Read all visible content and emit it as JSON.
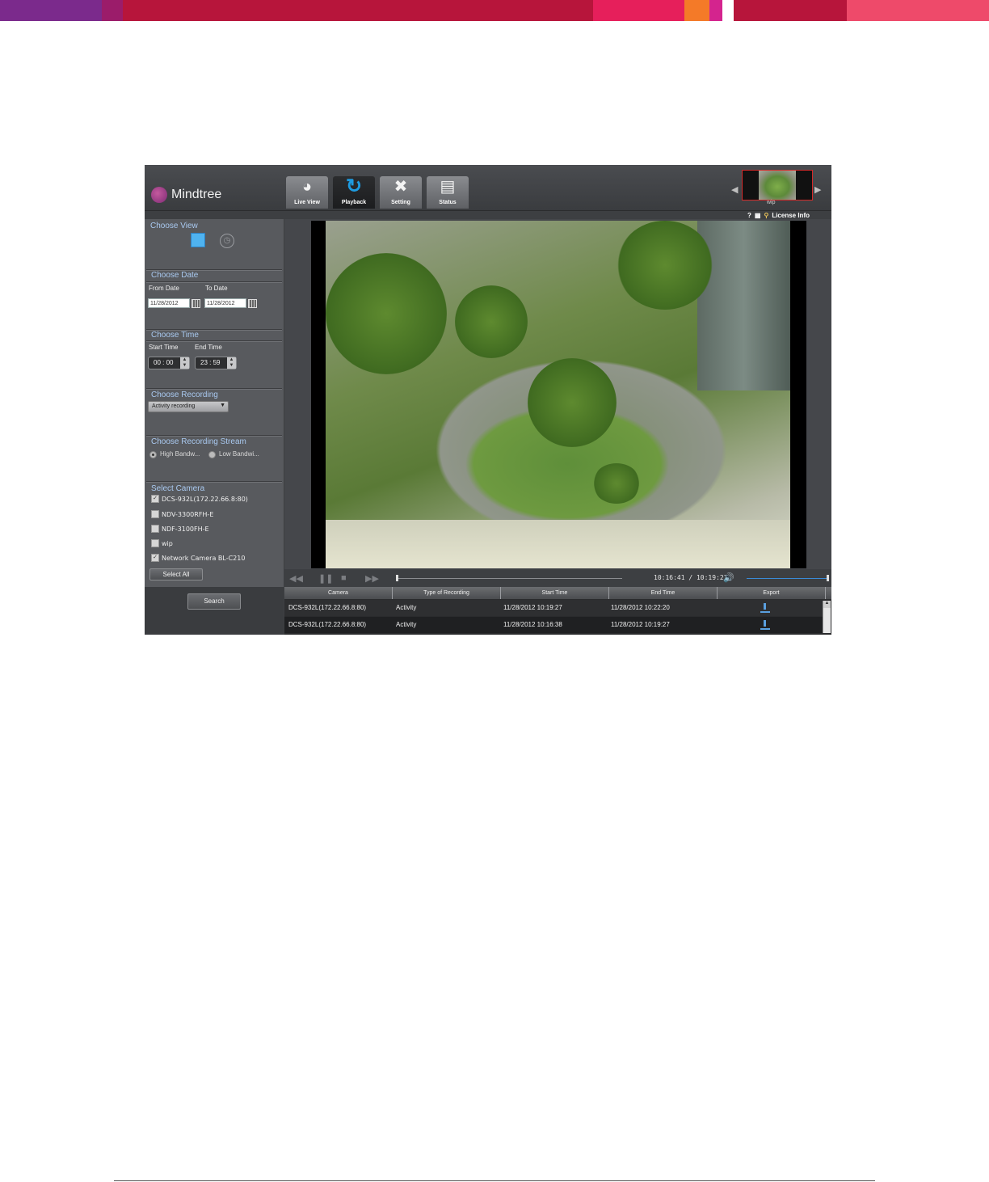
{
  "brand": {
    "name": "Mindtree"
  },
  "colors": {
    "accent": "#1e9be0",
    "section_title": "#a9c9f0",
    "panel": "#585a5e",
    "frame": "#3d3f42"
  },
  "nav": {
    "tabs": [
      {
        "label": "Live View",
        "icon": "dome-camera-icon"
      },
      {
        "label": "Playback",
        "icon": "refresh-icon",
        "active": true
      },
      {
        "label": "Setting",
        "icon": "tools-icon"
      },
      {
        "label": "Status",
        "icon": "document-icon"
      }
    ]
  },
  "camera_thumb": {
    "caption": "wip"
  },
  "util": {
    "help": "?",
    "license": "License Info"
  },
  "choose_view": {
    "title": "Choose View"
  },
  "choose_date": {
    "title": "Choose Date",
    "from_label": "From Date",
    "to_label": "To Date",
    "from_value": "11/28/2012",
    "to_value": "11/28/2012"
  },
  "choose_time": {
    "title": "Choose Time",
    "start_label": "Start Time",
    "end_label": "End Time",
    "start_value": "00 : 00",
    "end_value": "23 : 59"
  },
  "choose_recording": {
    "title": "Choose Recording",
    "selected": "Activity recording"
  },
  "choose_stream": {
    "title": "Choose Recording Stream",
    "high": "High Bandw...",
    "low": "Low Bandwi..."
  },
  "select_camera": {
    "title": "Select Camera",
    "cameras": [
      {
        "name": "DCS-932L(172.22.66.8:80)",
        "checked": true
      },
      {
        "name": "NDV-3300RFH-E",
        "checked": false
      },
      {
        "name": "NDF-3100FH-E",
        "checked": false
      },
      {
        "name": "wip",
        "checked": false
      },
      {
        "name": "Network Camera BL-C210",
        "checked": true
      }
    ],
    "select_all": "Select All"
  },
  "search": {
    "label": "Search"
  },
  "player": {
    "time": "10:16:41 / 10:19:27"
  },
  "results": {
    "columns": [
      "Camera",
      "Type of Recording",
      "Start Time",
      "End Time",
      "Export"
    ],
    "rows": [
      {
        "camera": "DCS-932L(172.22.66.8:80)",
        "type": "Activity",
        "start": "11/28/2012 10:19:27",
        "end": "11/28/2012 10:22:20"
      },
      {
        "camera": "DCS-932L(172.22.66.8:80)",
        "type": "Activity",
        "start": "11/28/2012 10:16:38",
        "end": "11/28/2012 10:19:27"
      }
    ]
  }
}
